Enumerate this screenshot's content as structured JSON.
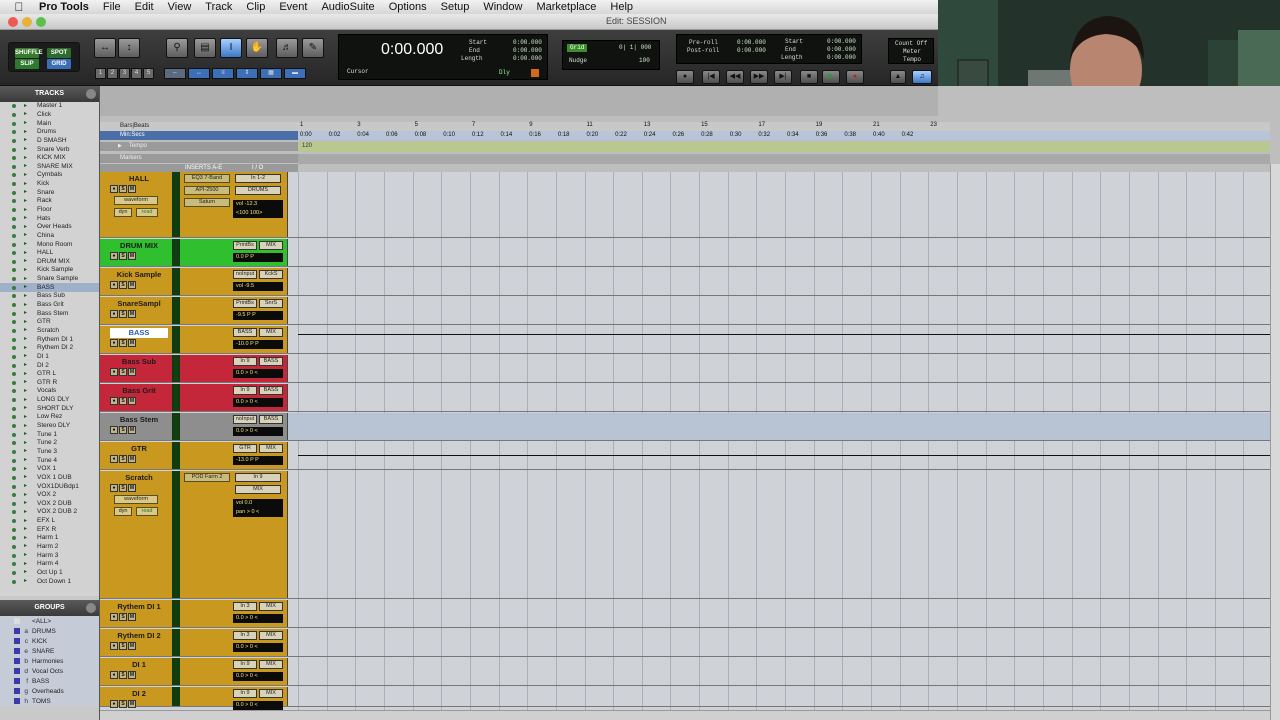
{
  "menubar": {
    "items": [
      "Pro Tools",
      "File",
      "Edit",
      "View",
      "Track",
      "Clip",
      "Event",
      "AudioSuite",
      "Options",
      "Setup",
      "Window",
      "Marketplace",
      "Help"
    ]
  },
  "window": {
    "title": "Edit: SESSION"
  },
  "toolbar": {
    "modes": [
      "SHUFFLE",
      "SPOT",
      "SLIP",
      "GRID"
    ],
    "zoom_presets": [
      "1",
      "2",
      "3",
      "4",
      "5"
    ],
    "main_counter": "0:00.000",
    "cursor_label": "Cursor",
    "start_label": "Start",
    "end_label": "End",
    "length_label": "Length",
    "start_val": "0:00.000",
    "end_val": "0:00.000",
    "length_val": "0:00.000",
    "dly_label": "Dly",
    "grid_label": "Grid",
    "grid_val": "0| 1| 000",
    "nudge_label": "Nudge",
    "nudge_val": "100",
    "preroll_label": "Pre-roll",
    "postroll_label": "Post-roll",
    "preroll_val": "0:00.000",
    "postroll_val": "0:00.000",
    "t_start_val": "0:00.000",
    "t_end_val": "0:00.000",
    "t_length_val": "0:00.000",
    "countoff": "Count Off",
    "meter": "Meter",
    "tempo": "Tempo",
    "colors": {
      "shuffle": "#3a7a2e",
      "spot": "#2d6a2d",
      "slip": "#2e7a2e",
      "grid": "#3a6fb8"
    }
  },
  "tracks_panel": {
    "header": "TRACKS",
    "items": [
      "Master 1",
      "Click",
      "Main",
      "Drums",
      "D SMASH",
      "Snare Verb",
      "KICK MIX",
      "SNARE MIX",
      "Cymbals",
      "Kick",
      "Snare",
      "Rack",
      "Floor",
      "Hats",
      "Over Heads",
      "China",
      "Mono Room",
      "HALL",
      "DRUM MIX",
      "Kick Sample",
      "Snare Sample",
      "BASS",
      "Bass Sub",
      "Bass Grit",
      "Bass Stem",
      "GTR",
      "Scratch",
      "Rythem DI 1",
      "Rythem DI 2",
      "DI 1",
      "DI 2",
      "GTR L",
      "GTR R",
      "Vocals",
      "LONG DLY",
      "SHORT DLY",
      "Low Rez",
      "Stereo DLY",
      "Tune 1",
      "Tune 2",
      "Tune 3",
      "Tune 4",
      "VOX 1",
      "VOX 1 DUB",
      "VOX1DUBdp1",
      "VOX 2",
      "VOX 2 DUB",
      "VOX 2 DUB 2",
      "EFX L",
      "EFX R",
      "Harm 1",
      "Harm 2",
      "Harm 3",
      "Harm 4",
      "Oct Up 1",
      "Oct Down 1"
    ],
    "selected": "BASS"
  },
  "groups_panel": {
    "header": "GROUPS",
    "items": [
      {
        "id": "",
        "name": "<ALL>",
        "color": "#dddddd"
      },
      {
        "id": "a",
        "name": "DRUMS",
        "color": "#3a3aa8"
      },
      {
        "id": "c",
        "name": "KICK",
        "color": "#3a3aa8"
      },
      {
        "id": "e",
        "name": "SNARE",
        "color": "#3a3aa8"
      },
      {
        "id": "b",
        "name": "Harmonies",
        "color": "#3a3aa8"
      },
      {
        "id": "d",
        "name": "Vocal Octs",
        "color": "#3a3aa8"
      },
      {
        "id": "f",
        "name": "BASS",
        "color": "#3a3aa8"
      },
      {
        "id": "g",
        "name": "Overheads",
        "color": "#3a3aa8"
      },
      {
        "id": "h",
        "name": "TOMS",
        "color": "#3a3aa8"
      }
    ]
  },
  "rulers": {
    "bars_beats": "Bars|Beats",
    "min_secs": "Min:Secs",
    "tempo": "Tempo",
    "markers": "Markers",
    "tempo_value": "120",
    "bar_ticks": [
      "1",
      "3",
      "5",
      "7",
      "9",
      "11",
      "13",
      "15",
      "17",
      "19",
      "21",
      "23"
    ],
    "sec_ticks": [
      "0:00",
      "0:02",
      "0:04",
      "0:06",
      "0:08",
      "0:10",
      "0:12",
      "0:14",
      "0:16",
      "0:18",
      "0:20",
      "0:22",
      "0:24",
      "0:26",
      "0:28",
      "0:30",
      "0:32",
      "0:34",
      "0:36",
      "0:38",
      "0:40",
      "0:42"
    ]
  },
  "column_headers": {
    "inserts": "INSERTS A-E",
    "io": "I / O"
  },
  "tracks": [
    {
      "name": "HALL",
      "color": "#c9981e",
      "height": 66,
      "inserts": [
        "EQ3 7-Band",
        "API-2500",
        "Saturn"
      ],
      "io": [
        "In 1-2",
        "DRUMS"
      ],
      "vol": "vol   -12.3",
      "pan": "<100  100>",
      "waveform": "waveform",
      "dyn": "dyn",
      "read": "read"
    },
    {
      "name": "DRUM MIX",
      "color": "#2fbf2f",
      "height": 28,
      "io": [
        "PrintBs",
        "MIX"
      ],
      "vol": "0.0  P  P"
    },
    {
      "name": "Kick Sample",
      "color": "#c9981e",
      "height": 28,
      "io": [
        "noInput",
        "KckS"
      ],
      "vol": "vol   -9.5"
    },
    {
      "name": "SnareSampl",
      "color": "#c9981e",
      "height": 28,
      "io": [
        "PrintBs",
        "SnrS"
      ],
      "vol": "-9.5  P  P"
    },
    {
      "name": "BASS",
      "color": "#c9981e",
      "height": 28,
      "io": [
        "BASS",
        "MIX"
      ],
      "vol": "-10.0  P  P"
    },
    {
      "name": "Bass Sub",
      "color": "#c4273a",
      "height": 28,
      "io": [
        "In 9",
        "BASS"
      ],
      "vol": "0.0  > 0 <"
    },
    {
      "name": "Bass Grit",
      "color": "#c4273a",
      "height": 28,
      "io": [
        "In 9",
        "BASS"
      ],
      "vol": "0.0  > 0 <"
    },
    {
      "name": "Bass Stem",
      "color": "#8e8e8e",
      "height": 28,
      "io": [
        "noInput",
        "BASS"
      ],
      "vol": "0.0  > 0 <"
    },
    {
      "name": "GTR",
      "color": "#c9981e",
      "height": 28,
      "io": [
        "GTR",
        "MIX"
      ],
      "vol": "-13.0  P  P"
    },
    {
      "name": "Scratch",
      "color": "#c9981e",
      "height": 128,
      "inserts": [
        "POD Farm 2"
      ],
      "io": [
        "In 9",
        "MIX"
      ],
      "vol": "vol     0.0",
      "pan": "pan  > 0 <",
      "waveform": "waveform",
      "dyn": "dyn",
      "read": "read"
    },
    {
      "name": "Rythem DI 1",
      "color": "#c9981e",
      "height": 28,
      "io": [
        "In 3",
        "MIX"
      ],
      "vol": "0.0  > 0 <"
    },
    {
      "name": "Rythem DI 2",
      "color": "#c9981e",
      "height": 28,
      "io": [
        "In 3",
        "MIX"
      ],
      "vol": "0.0  > 0 <"
    },
    {
      "name": "DI 1",
      "color": "#c9981e",
      "height": 28,
      "io": [
        "In 9",
        "MIX"
      ],
      "vol": "0.0  > 0 <"
    },
    {
      "name": "DI 2",
      "color": "#c9981e",
      "height": 20,
      "io": [
        "In 9",
        "MIX"
      ],
      "vol": "0.0  > 0 <"
    }
  ]
}
